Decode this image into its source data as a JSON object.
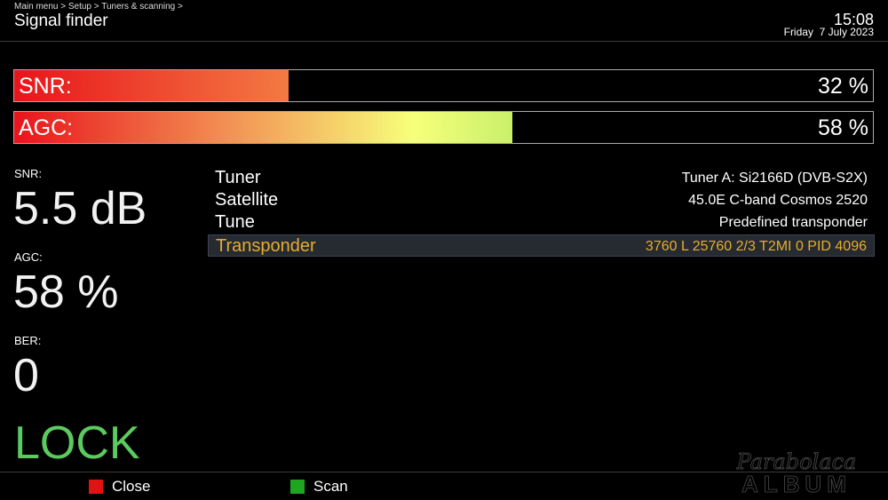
{
  "header": {
    "breadcrumb": "Main menu > Setup > Tuners & scanning >",
    "title": "Signal finder",
    "time": "15:08",
    "date": "Friday  7 July 2023"
  },
  "bars": {
    "snr": {
      "label": "SNR:",
      "value": "32 %",
      "fraction": 0.32,
      "color_start": "#e8141c",
      "color_end": "#f37a42"
    },
    "agc": {
      "label": "AGC:",
      "value": "58 %",
      "fraction": 0.58,
      "color_start": "#e8141c",
      "color_end": "#c9f06a"
    }
  },
  "stats": {
    "snr": {
      "label": "SNR:",
      "value": "5.5 dB"
    },
    "agc": {
      "label": "AGC:",
      "value": "58 %"
    },
    "ber": {
      "label": "BER:",
      "value": "0"
    },
    "lock": "LOCK"
  },
  "info": [
    {
      "key": "Tuner",
      "value": "Tuner A: Si2166D (DVB-S2X)"
    },
    {
      "key": "Satellite",
      "value": "45.0E C-band Cosmos 2520"
    },
    {
      "key": "Tune",
      "value": "Predefined transponder"
    },
    {
      "key": "Transponder",
      "value": "3760 L 25760 2/3 T2MI 0 PID 4096",
      "selected": true
    }
  ],
  "footer": {
    "close_label": "Close",
    "close_color": "#e01313",
    "scan_label": "Scan",
    "scan_color": "#1fa51f"
  },
  "watermark": {
    "line1": "Parabolaca",
    "line2": "ALBUM"
  },
  "colors": {
    "background": "#000000",
    "selected_text": "#e6ad2e",
    "lock_green": "#5ccb5f"
  }
}
